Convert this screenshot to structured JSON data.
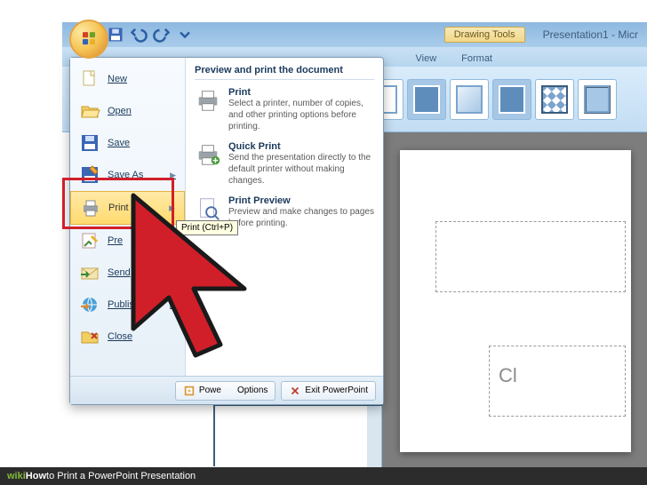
{
  "titlebar": {
    "drawing_tools": "Drawing Tools",
    "app_title": "Presentation1 - Micr"
  },
  "ribbon_tabs": {
    "view": "View",
    "format": "Format"
  },
  "office_menu": {
    "left": {
      "new": "New",
      "open": "Open",
      "save": "Save",
      "save_as": "Save As",
      "print": "Print",
      "prepare": "Pre",
      "send": "Send",
      "publish": "Publish",
      "close": "Close"
    },
    "right": {
      "header": "Preview and print the document",
      "print_title": "Print",
      "print_desc": "Select a printer, number of copies, and other printing options before printing.",
      "quick_title": "Quick Print",
      "quick_desc": "Send the presentation directly to the default printer without making changes.",
      "preview_title": "Print Preview",
      "preview_desc": "Preview and make changes to pages before printing."
    },
    "footer": {
      "options": "Options",
      "exit": "Exit PowerPoint",
      "brand": "Powe"
    }
  },
  "tooltip": "Print (Ctrl+P)",
  "slide": {
    "ph2_text": "Cl"
  },
  "wiki": {
    "brand": "wiki",
    "how": "How",
    "title": " to Print a PowerPoint Presentation"
  }
}
